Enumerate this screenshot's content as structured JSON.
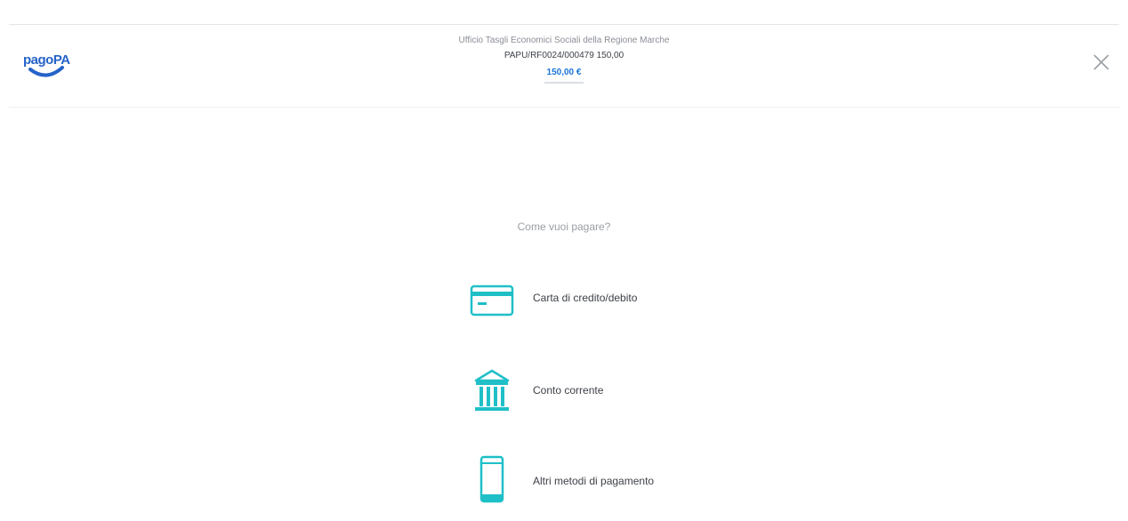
{
  "header": {
    "logo_text": "pagoPA",
    "creditor": "Ufficio Tasgli Economici Sociali della Regione Marche",
    "notice": "PAPU/RF0024/000479 150,00",
    "amount": "150,00 €"
  },
  "main": {
    "question": "Come vuoi pagare?",
    "methods": [
      {
        "label": "Carta di credito/debito",
        "icon": "credit-card-icon"
      },
      {
        "label": "Conto corrente",
        "icon": "bank-icon"
      },
      {
        "label": "Altri metodi di pagamento",
        "icon": "smartphone-icon"
      }
    ]
  },
  "colors": {
    "accent": "#1fbfc8",
    "brand": "#2563c9",
    "amount": "#1a73d9"
  }
}
